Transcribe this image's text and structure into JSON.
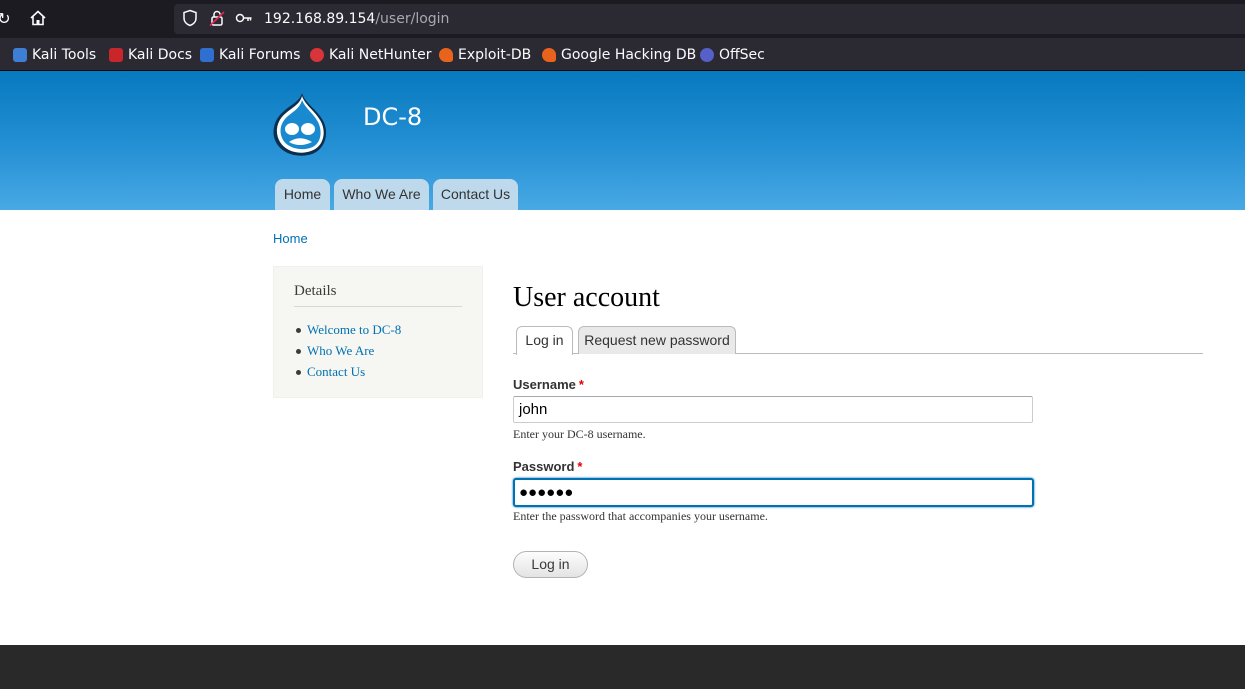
{
  "browser": {
    "url_host": "192.168.89.154",
    "url_path": "/user/login",
    "bookmarks": [
      {
        "label": "Kali Tools",
        "color": "#3d7fd4"
      },
      {
        "label": "Kali Docs",
        "color": "#c9262c"
      },
      {
        "label": "Kali Forums",
        "color": "#2f6fd0"
      },
      {
        "label": "Kali NetHunter",
        "color": "#d9343a"
      },
      {
        "label": "Exploit-DB",
        "color": "#e8641c"
      },
      {
        "label": "Google Hacking DB",
        "color": "#e8641c"
      },
      {
        "label": "OffSec",
        "color": "#5560c8"
      }
    ]
  },
  "site": {
    "name": "DC-8",
    "nav": [
      "Home",
      "Who We Are",
      "Contact Us"
    ]
  },
  "breadcrumb": "Home",
  "sidebar": {
    "title": "Details",
    "links": [
      "Welcome to DC-8",
      "Who We Are",
      "Contact Us"
    ]
  },
  "page": {
    "title": "User account",
    "tabs": [
      "Log in",
      "Request new password"
    ],
    "username_label": "Username",
    "username_value": "john",
    "username_desc": "Enter your DC-8 username.",
    "password_label": "Password",
    "password_value": "●●●●●●",
    "password_desc": "Enter the password that accompanies your username.",
    "required_mark": "*",
    "submit_label": "Log in"
  },
  "colors": {
    "header_top": "#0779bf",
    "header_bottom": "#48a9e4",
    "link": "#0071b3",
    "required": "#e00000",
    "footer": "#292929"
  }
}
